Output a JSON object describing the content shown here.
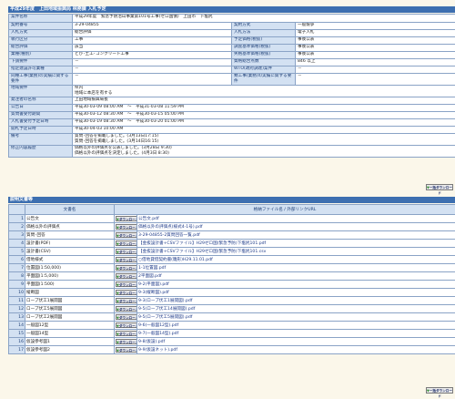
{
  "header": {
    "title": "平成29年度　上田地域振興局 林務課 入札予定"
  },
  "info": {
    "r1": {
      "l": "案件名称",
      "v": "平成29年度　緊急予防治山事業第101号工事(ゼロ国債)　上田市　下塩尻"
    },
    "r2": {
      "l1": "契約番号",
      "v1": "3-29-04855",
      "l2": "契約方式",
      "v2": "一般競争"
    },
    "r3": {
      "l1": "入札方式",
      "v1": "総合評価",
      "l2": "入札方法",
      "v2": "電子入札"
    },
    "r4": {
      "l1": "執行区分",
      "v1": "工事",
      "l2": "予定価格(税抜)",
      "v2": "事後公表"
    },
    "r5": {
      "l1": "総合評価",
      "v1": "該当",
      "l2": "調査基準価格(税抜)",
      "v2": "事後公表"
    },
    "r6": {
      "l1": "業種(種別)",
      "v1": "とび･土工･コンクリート工事",
      "l2": "失格基準価格(税抜)",
      "v2": "事後公表"
    },
    "r7": {
      "l1": "下請要件",
      "v1": "－",
      "l2": "資格総合点数",
      "v2": "846 以上"
    },
    "r8": {
      "l1": "指定建設許可業種",
      "v1": "－",
      "l2": "WTO(政府調達)案件",
      "v2": "－"
    },
    "r9": {
      "l1": "同種工事(業務)の実績に関する要件",
      "v1": "－",
      "l2": "類工事(業務)の実績に関する要件",
      "v2": "－"
    },
    "r10": {
      "l": "地域要件",
      "v1": "県内",
      "v2": "地域に本店を有する"
    },
    "r11": {
      "l": "発注者の名称",
      "v": "上田地域振興局長"
    },
    "r12": {
      "l": "公告日",
      "v": "平成30-03-09 08:00 AM　～　平成31-03-08 11:59 PM"
    },
    "r13": {
      "l": "質問書受付期間",
      "v": "平成30-03-12 08:30 AM　～　平成30-03-15 05:00 PM"
    },
    "r14": {
      "l": "入札書受付予定日時",
      "v": "平成30-03-19 08:30 AM　～　平成30-03-20 01:00 PM"
    },
    "r15": {
      "l": "開札予定日時",
      "v": "平成30-04-03 10:00 AM"
    },
    "r16": {
      "l": "備考",
      "v1": "質問･回答を掲載しました。(3月13日17:15)",
      "v2": "質問･回答を掲載しました。(3月14日16:15)"
    },
    "r17": {
      "l": "修正内容履歴",
      "v1": "価格以外の評価点を公表しました。(3月28日 9:30)",
      "v2": "価格以外の評価点を決定しました。(4月3日 8:30)"
    }
  },
  "bulk_download_label": "一括ダウンロード",
  "docs_section": {
    "title": "説明文書等",
    "col_doc": "文書名",
    "col_file": "格納ファイル名 / 外部リンクURL",
    "download_label": "ダウンロード",
    "rows": [
      {
        "no": "1",
        "name": "公告文",
        "file": "公告文.pdf"
      },
      {
        "no": "2",
        "name": "価格以外の評価点",
        "file": "価格以外の評価点(様式4-1号).pdf"
      },
      {
        "no": "3",
        "name": "質問･回答",
        "file": "3-29-04855-2質問回答一覧.pdf"
      },
      {
        "no": "4",
        "name": "設計書(PDF)",
        "file": "【金抜設計書+CSVファイル】H29ゼロ国(緊急予防)下塩尻101.pdf"
      },
      {
        "no": "5",
        "name": "設計書(CSV)",
        "file": "【金抜設計書+CSVファイル】H29ゼロ国(緊急予防)下塩尻101.csv"
      },
      {
        "no": "6",
        "name": "借地様式",
        "file": "○借地貸借契約書(雛形)H29.11.01.pdf"
      },
      {
        "no": "7",
        "name": "位置図(1:50,000)",
        "file": "1-1位置図.pdf"
      },
      {
        "no": "8",
        "name": "平面図(1:5,000)",
        "file": "2平面図.pdf"
      },
      {
        "no": "9",
        "name": "平面図(1:500)",
        "file": "9-2(平面図).pdf"
      },
      {
        "no": "10",
        "name": "縦断図",
        "file": "9-3(縦断図).pdf"
      },
      {
        "no": "11",
        "name": "ロープ伏工1展開図",
        "file": "9-3(ロープ伏工1展開図).pdf"
      },
      {
        "no": "12",
        "name": "ロープ伏工5展開図",
        "file": "9-5(ロープ伏工14展開図).pdf"
      },
      {
        "no": "13",
        "name": "ロープ伏工2展開図",
        "file": "9-5(ロープ伏工5展開図).pdf"
      },
      {
        "no": "14",
        "name": "一般図12型",
        "file": "9-6(一般図12型).pdf"
      },
      {
        "no": "15",
        "name": "一般図14型",
        "file": "9-7(一般図14型).pdf"
      },
      {
        "no": "16",
        "name": "仮設参考図1",
        "file": "9-8(仮設).pdf"
      },
      {
        "no": "17",
        "name": "仮設参考図2",
        "file": "9-9(仮設ネット).pdf"
      }
    ]
  }
}
